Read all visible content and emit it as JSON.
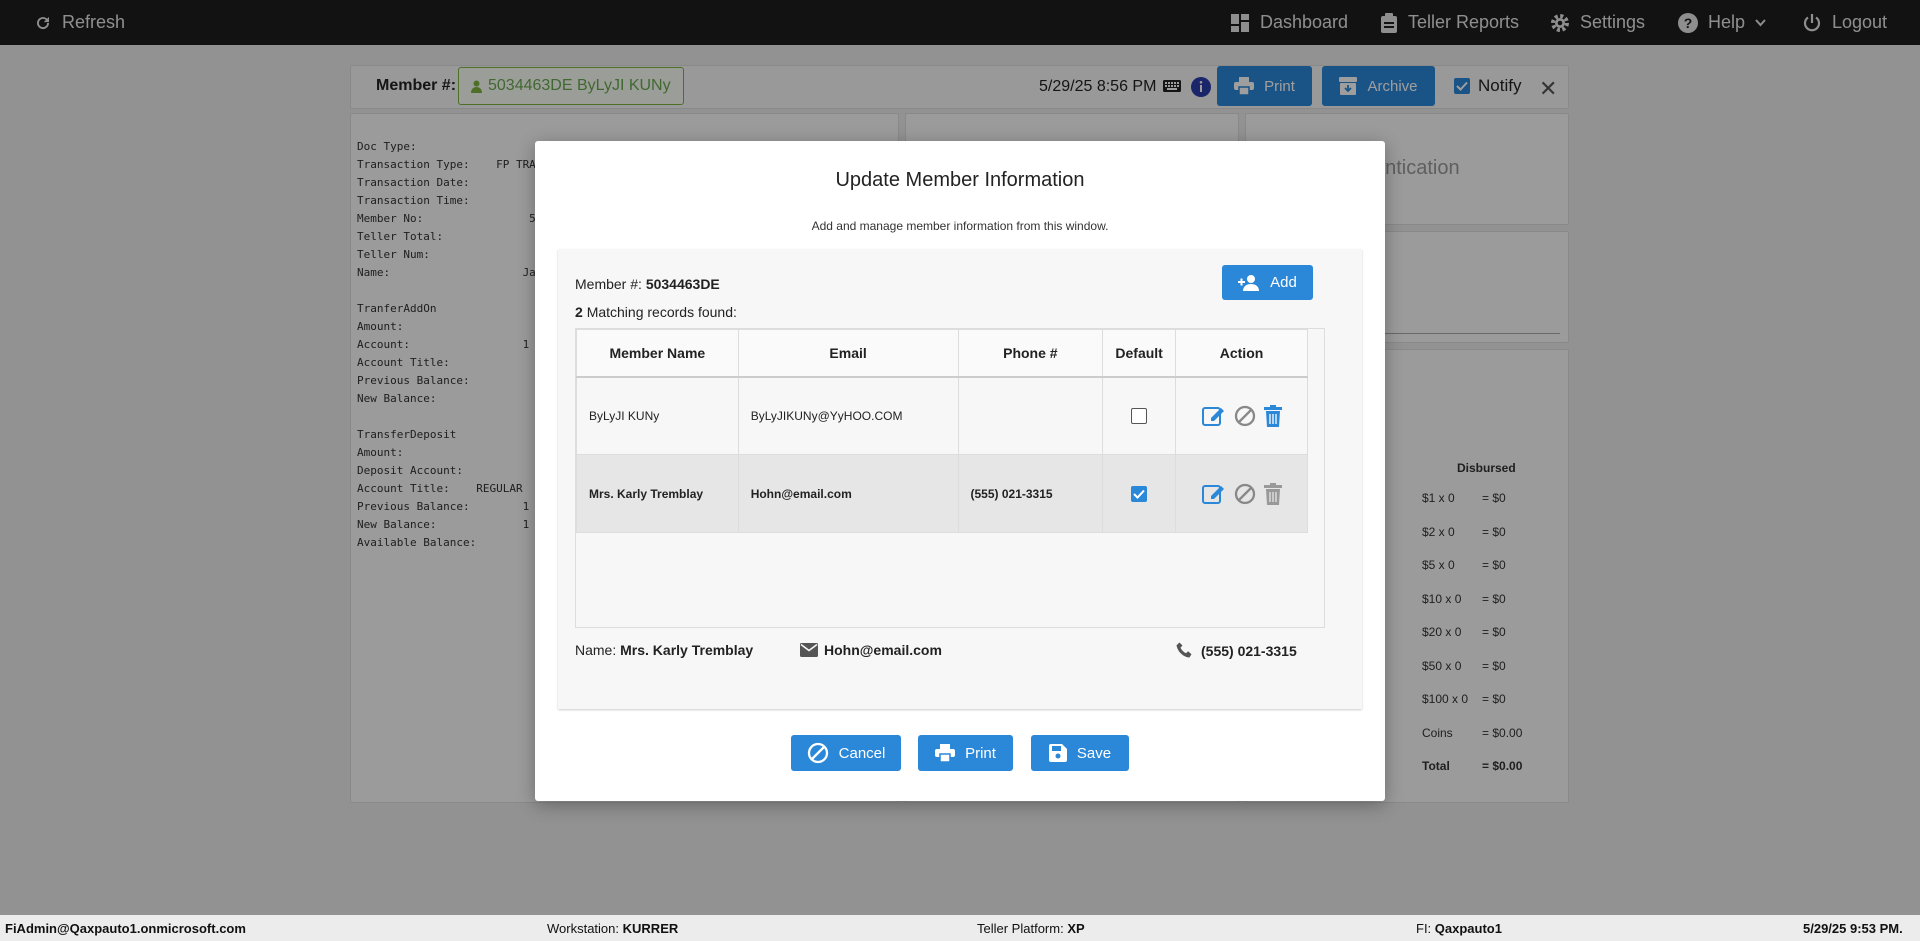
{
  "nav": {
    "refresh": "Refresh",
    "dashboard": "Dashboard",
    "teller_reports": "Teller Reports",
    "settings": "Settings",
    "help": "Help",
    "logout": "Logout"
  },
  "member_bar": {
    "label": "Member #:",
    "member": "5034463DE ByLyJI KUNy",
    "datetime": "5/29/25 8:56 PM",
    "print": "Print",
    "archive": "Archive",
    "notify": "Notify"
  },
  "receipt": {
    "lines": [
      "Doc Type:",
      "Transaction Type:    FP TRA",
      "Transaction Date:",
      "Transaction Time:",
      "Member No:                5",
      "Teller Total:",
      "Teller Num:",
      "Name:                    Ja",
      "",
      "TranferAddOn",
      "Amount:",
      "Account:                 1",
      "Account Title:",
      "Previous Balance:",
      "New Balance:",
      "",
      "TransferDeposit",
      "Amount:",
      "Deposit Account:",
      "Account Title:    REGULAR",
      "Previous Balance:        1",
      "New Balance:             1",
      "Available Balance:"
    ]
  },
  "auth": {
    "title": "entication"
  },
  "cash": {
    "header": "Disbursed",
    "rows": [
      {
        "d": "$1 x 0",
        "v": "= $0"
      },
      {
        "d": "$2 x 0",
        "v": "= $0"
      },
      {
        "d": "$5 x 0",
        "v": "= $0"
      },
      {
        "d": "$10 x 0",
        "v": "= $0"
      },
      {
        "d": "$20 x 0",
        "v": "= $0"
      },
      {
        "d": "$50 x 0",
        "v": "= $0"
      },
      {
        "d": "$100 x 0",
        "v": "= $0"
      },
      {
        "d": "Coins",
        "v": "= $0.00"
      },
      {
        "d": "Total",
        "v": "= $0.00"
      }
    ]
  },
  "modal": {
    "title": "Update Member Information",
    "subtitle": "Add and manage member information from this window.",
    "member_label": "Member #:",
    "member_no": "5034463DE",
    "match_count": "2",
    "match_text": "Matching records found:",
    "add": "Add",
    "columns": [
      "Member Name",
      "Email",
      "Phone #",
      "Default",
      "Action"
    ],
    "rows": [
      {
        "name": "ByLyJI KUNy",
        "email": "ByLyJIKUNy@YyHOO.COM",
        "phone": "",
        "default": false
      },
      {
        "name": "Mrs. Karly Tremblay",
        "email": "Hohn@email.com",
        "phone": "(555) 021-3315",
        "default": true
      }
    ],
    "summary": {
      "name_label": "Name:",
      "name": "Mrs. Karly Tremblay",
      "email": "Hohn@email.com",
      "phone": "(555) 021-3315"
    },
    "cancel": "Cancel",
    "print": "Print",
    "save": "Save"
  },
  "status": {
    "user": "FiAdmin@Qaxpauto1.onmicrosoft.com",
    "workstation_label": "Workstation:",
    "workstation": "KURRER",
    "platform_label": "Teller Platform:",
    "platform": "XP",
    "fi_label": "FI:",
    "fi": "Qaxpauto1",
    "datetime": "5/29/25 9:53 PM."
  },
  "colors": {
    "primary": "#2b87d8",
    "nav_bg": "#1e1e1e",
    "member_green": "#6aa84f"
  }
}
